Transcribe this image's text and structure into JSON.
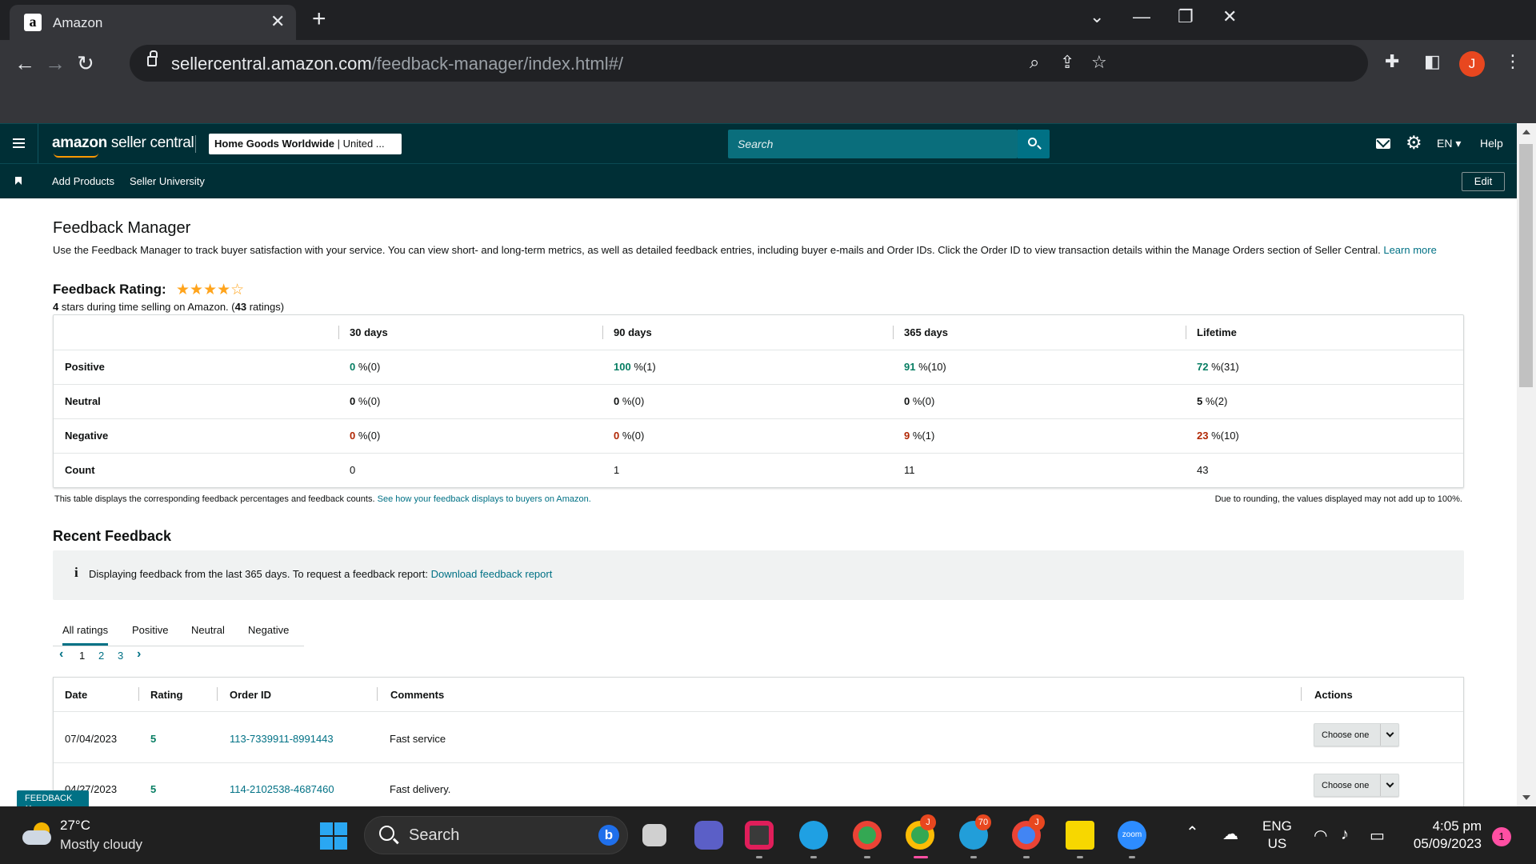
{
  "browser": {
    "tab_title": "Amazon",
    "tab_favicon": "a",
    "new_tab": "+",
    "url_host": "sellercentral.amazon.com",
    "url_path": "/feedback-manager/index.html#/",
    "profile_initial": "J",
    "icons": [
      "back-icon",
      "forward-icon",
      "reload-icon",
      "lock-icon",
      "zoom-icon",
      "share-icon",
      "star-icon",
      "extensions-icon",
      "sidepanel-icon",
      "menu-dots-icon"
    ]
  },
  "header": {
    "logo_bold": "amazon",
    "logo_rest": " seller central",
    "store_name": "Home Goods Worldwide",
    "store_region": " | United ...",
    "search_placeholder": "Search",
    "language": "EN",
    "help": "Help"
  },
  "nav": {
    "links": [
      "Add Products",
      "Seller University"
    ],
    "edit": "Edit"
  },
  "page": {
    "title": "Feedback Manager",
    "intro": "Use the Feedback Manager to track buyer satisfaction with your service. You can view short- and long-term metrics, as well as detailed feedback entries, including buyer e-mails and Order IDs. Click the Order ID to view transaction details within the Manage Orders section of Seller Central.",
    "learn_more": "Learn more",
    "rating_label": "Feedback Rating:",
    "stars_filled": "★★★★",
    "stars_empty": "☆",
    "rating_stars": "4",
    "rating_mid": " stars during time selling on Amazon. (",
    "rating_count": "43",
    "rating_end": " ratings)"
  },
  "metrics": {
    "columns": [
      "30 days",
      "90 days",
      "365 days",
      "Lifetime"
    ],
    "rows": [
      {
        "label": "Positive",
        "cells": [
          {
            "v": "0",
            "r": " %(0)"
          },
          {
            "v": "100",
            "r": " %(1)"
          },
          {
            "v": "91",
            "r": " %(10)"
          },
          {
            "v": "72",
            "r": " %(31)"
          }
        ]
      },
      {
        "label": "Neutral",
        "cells": [
          {
            "v": "0",
            "r": " %(0)"
          },
          {
            "v": "0",
            "r": " %(0)"
          },
          {
            "v": "0",
            "r": " %(0)"
          },
          {
            "v": "5",
            "r": " %(2)"
          }
        ]
      },
      {
        "label": "Negative",
        "cells": [
          {
            "v": "0",
            "r": " %(0)"
          },
          {
            "v": "0",
            "r": " %(0)"
          },
          {
            "v": "9",
            "r": " %(1)"
          },
          {
            "v": "23",
            "r": " %(10)"
          }
        ]
      },
      {
        "label": "Count",
        "cells": [
          {
            "v": "0",
            "r": ""
          },
          {
            "v": "1",
            "r": ""
          },
          {
            "v": "11",
            "r": ""
          },
          {
            "v": "43",
            "r": ""
          }
        ]
      }
    ],
    "note": "This table displays the corresponding feedback percentages and feedback counts.",
    "note_link": "See how your feedback displays to buyers on Amazon.",
    "rounding_note": "Due to rounding, the values displayed may not add up to 100%."
  },
  "recent": {
    "title": "Recent Feedback",
    "info_icon": "i",
    "info_text": "Displaying feedback from the last 365 days. To request a feedback report:",
    "info_link": "Download feedback report",
    "tabs": [
      "All ratings",
      "Positive",
      "Neutral",
      "Negative"
    ],
    "pages": [
      "1",
      "2",
      "3"
    ],
    "prev": "‹",
    "next": "›",
    "columns": [
      "Date",
      "Rating",
      "Order ID",
      "Comments",
      "Actions"
    ],
    "rows": [
      {
        "date": "07/04/2023",
        "rating": "5",
        "order_id": "113-7339911-8991443",
        "comment": "Fast service",
        "action": "Choose one"
      },
      {
        "date": "04/27/2023",
        "rating": "5",
        "order_id": "114-2102538-4687460",
        "comment": "Fast delivery.",
        "action": "Choose one"
      }
    ]
  },
  "feedback_tab": "FEEDBACK ✕",
  "taskbar": {
    "temperature": "27°C",
    "condition": "Mostly cloudy",
    "search": "Search",
    "bing": "b",
    "badge_telegram": "70",
    "badge_j": "J",
    "zoom_label": "zoom",
    "lang_line1": "ENG",
    "lang_line2": "US",
    "time": "4:05 pm",
    "date": "05/09/2023",
    "notifications": "1"
  },
  "colors": {
    "header_bg": "#002f36",
    "link": "#007185",
    "positive": "#067d62",
    "negative": "#b12704",
    "star": "#ffa41c"
  }
}
